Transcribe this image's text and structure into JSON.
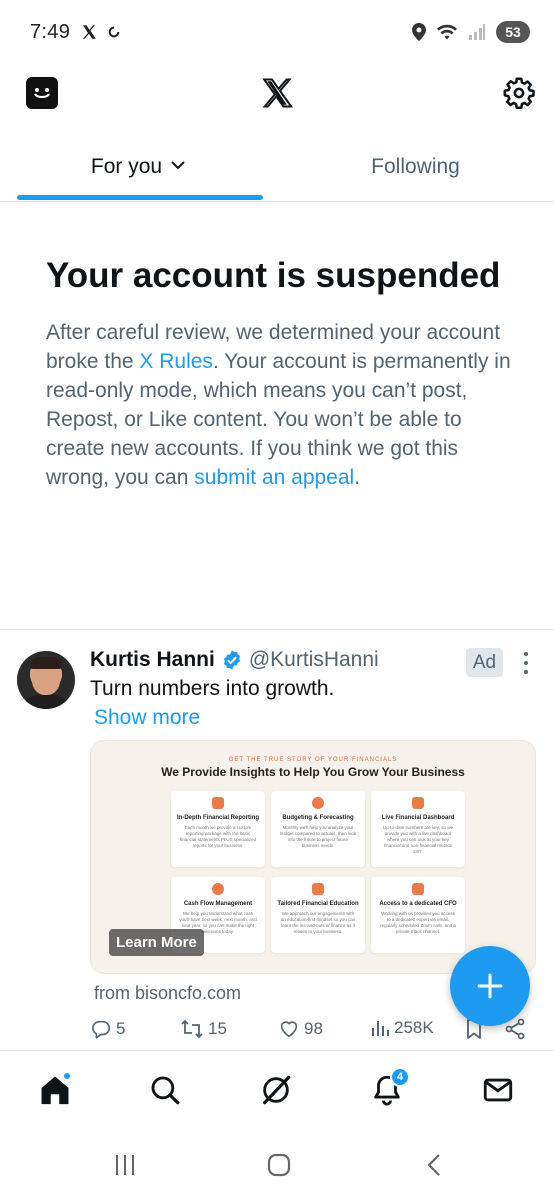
{
  "status_bar": {
    "time": "7:49",
    "battery": "53"
  },
  "tabs": [
    {
      "label": "For you",
      "active": true
    },
    {
      "label": "Following",
      "active": false
    }
  ],
  "suspended": {
    "title": "Your account is suspended",
    "body_1": "After careful review, we determined your account broke the ",
    "rules_link": "X Rules",
    "body_2": ". Your account is permanently in read-only mode, which means you can’t post, Repost, or Like content. You won’t be able to create new accounts. If you think we got this wrong, you can ",
    "appeal_link": "submit an appeal",
    "body_3": "."
  },
  "tweet": {
    "name": "Kurtis Hanni",
    "handle": "@KurtisHanni",
    "ad_label": "Ad",
    "text": "Turn numbers into growth.",
    "show_more": "Show more",
    "card": {
      "kicker": "GET THE TRUE STORY OF YOUR FINANCIALS",
      "title": "We Provide Insights to Help You Grow Your Business",
      "features": [
        {
          "title": "In-Depth Financial Reporting",
          "desc": "Each month we provide a custom reporting package with the basic financial statements PLUS specialized reports for your business."
        },
        {
          "title": "Budgeting & Forecasting",
          "desc": "Monthly we'll help you analyze your budget compared to actuals, then look into the future to project future business needs."
        },
        {
          "title": "Live Financial Dashboard",
          "desc": "Up-to-date numbers are key, so we provide you with a live dashboard where you can look at your key financial and non-financial metrics 24/7."
        },
        {
          "title": "Cash Flow Management",
          "desc": "We help you understand what cash you'll have next week, next month, and next year, so you can make the right decisions today."
        },
        {
          "title": "Tailored Financial Education",
          "desc": "We approach our engagements with an education-first mindset so you can learn the ins-and-outs of finance as it relates to your business."
        },
        {
          "title": "Access to a dedicated CFO",
          "desc": "Working with us provides you access to a dedicated expert via email, regularly scheduled Zoom calls, and a private Slack channel."
        }
      ],
      "learn_more": "Learn More"
    },
    "from": "from bisoncfo.com",
    "stats": {
      "replies": "5",
      "reposts": "15",
      "likes": "98",
      "views": "258K"
    }
  },
  "bottom_nav": {
    "notifications_count": "4"
  },
  "colors": {
    "accent": "#1d9bf0",
    "text_primary": "#0f1419",
    "text_secondary": "#536471"
  }
}
